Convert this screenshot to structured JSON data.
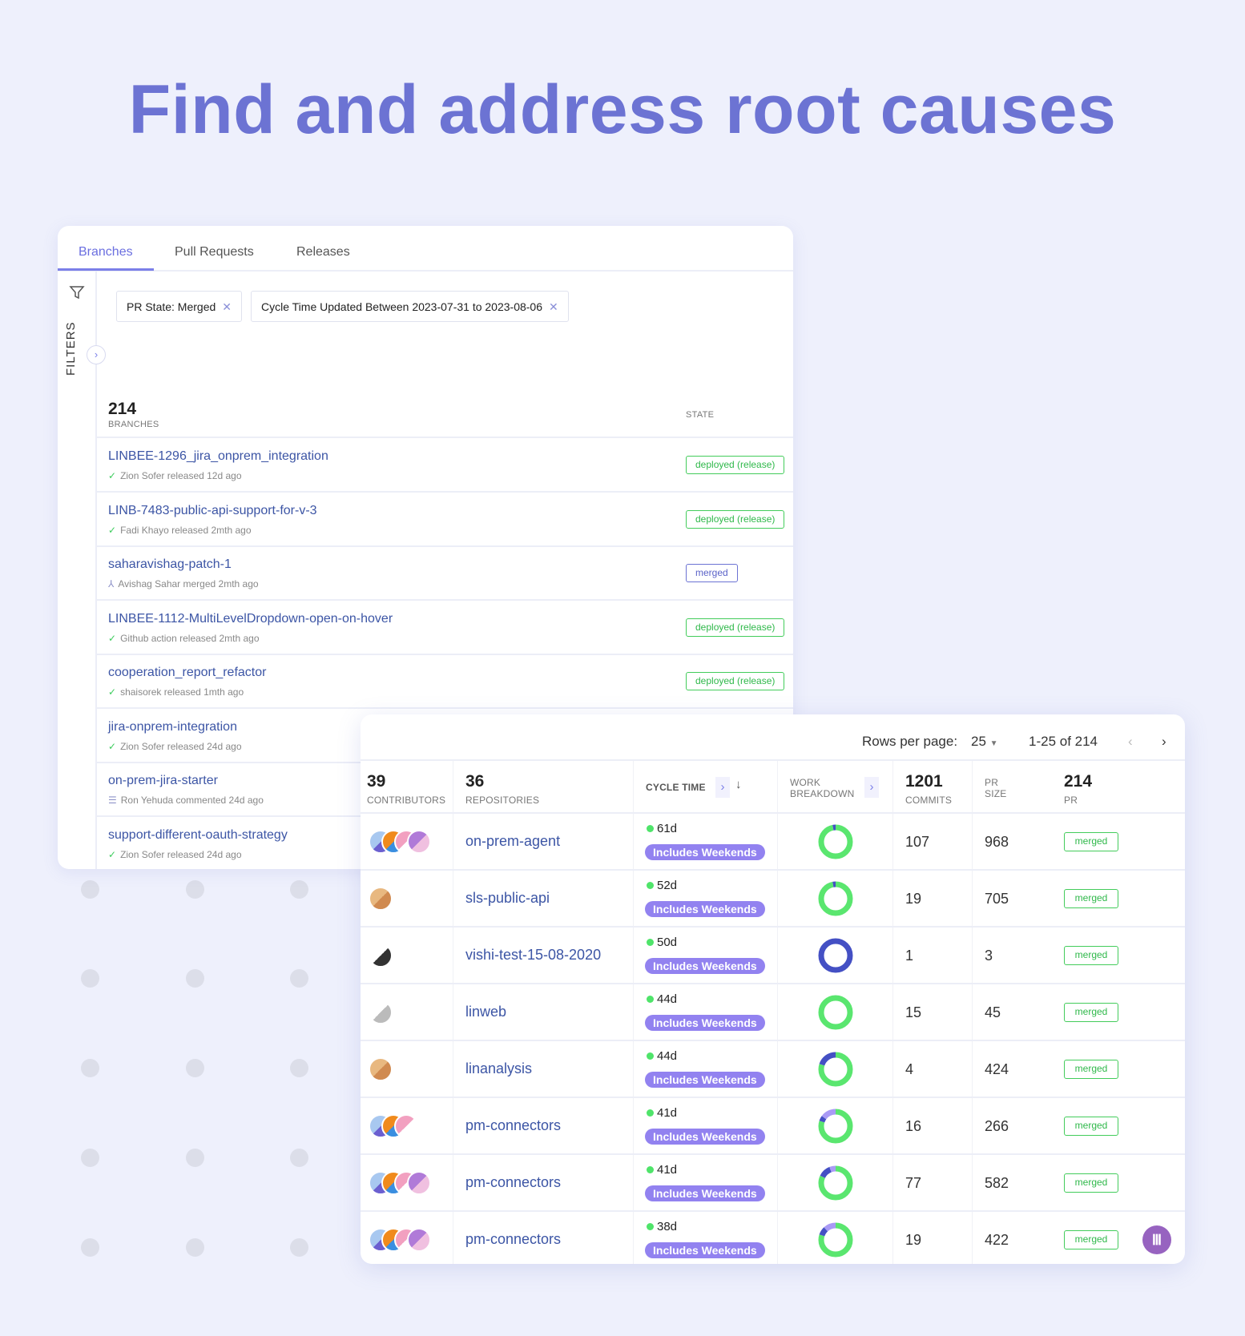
{
  "headline": "Find and address root causes",
  "branches_card": {
    "tabs": [
      {
        "label": "Branches",
        "active": true
      },
      {
        "label": "Pull Requests",
        "active": false
      },
      {
        "label": "Releases",
        "active": false
      }
    ],
    "filters_label": "FILTERS",
    "filter_chips": [
      "PR State: Merged",
      "Cycle Time Updated Between 2023-07-31 to 2023-08-06"
    ],
    "count": "214",
    "count_label": "BRANCHES",
    "state_header": "STATE",
    "rows": [
      {
        "name": "LINBEE-1296_jira_onprem_integration",
        "sub": "Zion Sofer released 12d ago",
        "icon": "check-circle-icon",
        "state": "deployed (release)"
      },
      {
        "name": "LINB-7483-public-api-support-for-v-3",
        "sub": "Fadi Khayo released 2mth ago",
        "icon": "check-circle-icon",
        "state": "deployed (release)"
      },
      {
        "name": "saharavishag-patch-1",
        "sub": "Avishag Sahar merged 2mth ago",
        "icon": "merge-icon",
        "state": "merged"
      },
      {
        "name": "LINBEE-1112-MultiLevelDropdown-open-on-hover",
        "sub": "Github action released 2mth ago",
        "icon": "check-circle-icon",
        "state": "deployed (release)"
      },
      {
        "name": "cooperation_report_refactor",
        "sub": "shaisorek released 1mth ago",
        "icon": "check-circle-icon",
        "state": "deployed (release)"
      },
      {
        "name": "jira-onprem-integration",
        "sub": "Zion Sofer released 24d ago",
        "icon": "check-circle-icon",
        "state": ""
      },
      {
        "name": "on-prem-jira-starter",
        "sub": "Ron Yehuda commented 24d ago",
        "icon": "comment-icon",
        "state": ""
      },
      {
        "name": "support-different-oauth-strategy",
        "sub": "Zion Sofer released 24d ago",
        "icon": "check-circle-icon",
        "state": ""
      }
    ]
  },
  "pr_table": {
    "rows_per_page_label": "Rows per page:",
    "rows_per_page": "25",
    "range": "1-25 of 214",
    "headers": {
      "contributors": {
        "count": "39",
        "label": "CONTRIBUTORS"
      },
      "repositories": {
        "count": "36",
        "label": "REPOSITORIES"
      },
      "cycle_time": {
        "label": "CYCLE TIME"
      },
      "work_breakdown": {
        "label1": "WORK",
        "label2": "BREAKDOWN"
      },
      "commits": {
        "count": "1201",
        "label": "COMMITS"
      },
      "pr_size": {
        "label1": "PR",
        "label2": "SIZE"
      },
      "pr": {
        "count": "214",
        "label": "PR"
      }
    },
    "weekend_label": "Includes Weekends",
    "colors": {
      "green": "#5ae66f",
      "blue": "#4450c4",
      "lavender": "#a99af5",
      "accent": "#6c73d3"
    },
    "rows": [
      {
        "avatars": 4,
        "repo": "on-prem-agent",
        "cycle": "61d",
        "breakdown": [
          0.97,
          0.03,
          0
        ],
        "commits": "107",
        "size": "968",
        "state": "merged"
      },
      {
        "avatars": 1,
        "repo": "sls-public-api",
        "cycle": "52d",
        "breakdown": [
          0.97,
          0.03,
          0
        ],
        "commits": "19",
        "size": "705",
        "state": "merged"
      },
      {
        "avatars": 1,
        "repo": "vishi-test-15-08-2020",
        "cycle": "50d",
        "breakdown": [
          0,
          1,
          0
        ],
        "commits": "1",
        "size": "3",
        "state": "merged"
      },
      {
        "avatars": 1,
        "repo": "linweb",
        "cycle": "44d",
        "breakdown": [
          1,
          0,
          0
        ],
        "commits": "15",
        "size": "45",
        "state": "merged"
      },
      {
        "avatars": 1,
        "repo": "linanalysis",
        "cycle": "44d",
        "breakdown": [
          0.8,
          0.2,
          0
        ],
        "commits": "4",
        "size": "424",
        "state": "merged"
      },
      {
        "avatars": 3,
        "repo": "pm-connectors",
        "cycle": "41d",
        "breakdown": [
          0.8,
          0.05,
          0.15
        ],
        "commits": "16",
        "size": "266",
        "state": "merged"
      },
      {
        "avatars": 4,
        "repo": "pm-connectors",
        "cycle": "41d",
        "breakdown": [
          0.82,
          0.12,
          0.06
        ],
        "commits": "77",
        "size": "582",
        "state": "merged"
      },
      {
        "avatars": 4,
        "repo": "pm-connectors",
        "cycle": "38d",
        "breakdown": [
          0.8,
          0.08,
          0.12
        ],
        "commits": "19",
        "size": "422",
        "state": "merged"
      }
    ]
  }
}
